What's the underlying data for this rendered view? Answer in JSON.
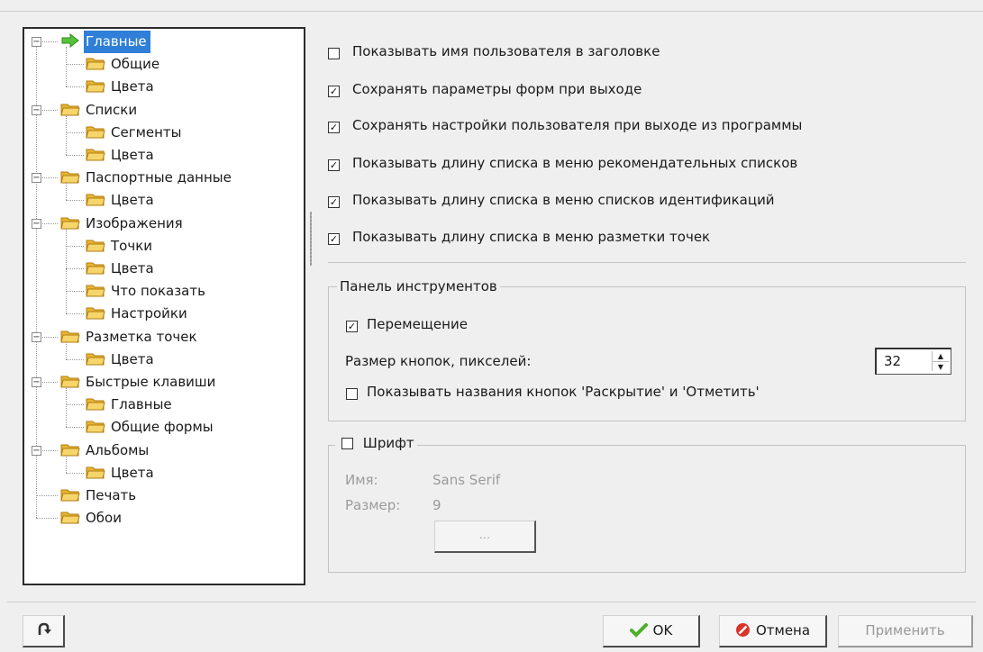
{
  "tree": {
    "items": [
      {
        "label": "Главные",
        "level": 0,
        "expander": "−",
        "icon": "arrow-right-icon",
        "selected": true
      },
      {
        "label": "Общие",
        "level": 1,
        "icon": "folder-icon"
      },
      {
        "label": "Цвета",
        "level": 1,
        "icon": "folder-icon"
      },
      {
        "label": "Списки",
        "level": 0,
        "expander": "−",
        "icon": "folder-icon"
      },
      {
        "label": "Сегменты",
        "level": 1,
        "icon": "folder-icon"
      },
      {
        "label": "Цвета",
        "level": 1,
        "icon": "folder-icon"
      },
      {
        "label": "Паспортные данные",
        "level": 0,
        "expander": "−",
        "icon": "folder-icon"
      },
      {
        "label": "Цвета",
        "level": 1,
        "icon": "folder-icon"
      },
      {
        "label": "Изображения",
        "level": 0,
        "expander": "−",
        "icon": "folder-icon"
      },
      {
        "label": "Точки",
        "level": 1,
        "icon": "folder-icon"
      },
      {
        "label": "Цвета",
        "level": 1,
        "icon": "folder-icon"
      },
      {
        "label": "Что показать",
        "level": 1,
        "icon": "folder-icon"
      },
      {
        "label": "Настройки",
        "level": 1,
        "icon": "folder-icon"
      },
      {
        "label": "Разметка точек",
        "level": 0,
        "expander": "−",
        "icon": "folder-icon"
      },
      {
        "label": "Цвета",
        "level": 1,
        "icon": "folder-icon"
      },
      {
        "label": "Быстрые клавиши",
        "level": 0,
        "expander": "−",
        "icon": "folder-icon"
      },
      {
        "label": "Главные",
        "level": 1,
        "icon": "folder-icon"
      },
      {
        "label": "Общие формы",
        "level": 1,
        "icon": "folder-icon"
      },
      {
        "label": "Альбомы",
        "level": 0,
        "expander": "−",
        "icon": "folder-icon"
      },
      {
        "label": "Цвета",
        "level": 1,
        "icon": "folder-icon"
      },
      {
        "label": "Печать",
        "level": 0,
        "icon": "folder-icon"
      },
      {
        "label": "Обои",
        "level": 0,
        "icon": "folder-icon"
      }
    ]
  },
  "options": [
    {
      "label": "Показывать имя пользователя в заголовке",
      "checked": false
    },
    {
      "label": "Сохранять параметры форм при выходе",
      "checked": true
    },
    {
      "label": "Сохранять настройки пользователя при выходе из программы",
      "checked": true
    },
    {
      "label": "Показывать длину списка в меню рекомендательных списков",
      "checked": true
    },
    {
      "label": "Показывать длину списка в меню списков идентификаций",
      "checked": true
    },
    {
      "label": "Показывать длину списка в меню разметки точек",
      "checked": true
    }
  ],
  "toolbar_group": {
    "title": "Панель инструментов",
    "move_label": "Перемещение",
    "move_checked": true,
    "size_label": "Размер кнопок, пикселей:",
    "size_value": "32",
    "show_names_label": "Показывать названия кнопок 'Раскрытие' и 'Отметить'",
    "show_names_checked": false
  },
  "font_group": {
    "title": "Шрифт",
    "checked": false,
    "name_label": "Имя:",
    "name_value": "Sans Serif",
    "size_label": "Размер:",
    "size_value": "9",
    "choose_label": "..."
  },
  "buttons": {
    "ok": "OK",
    "cancel": "Отмена",
    "apply": "Применить"
  },
  "colors": {
    "selection": "#2f7fd8",
    "folder": "#f2c84b",
    "ok_check": "#4caf2a",
    "cancel_icon": "#d9342b"
  }
}
